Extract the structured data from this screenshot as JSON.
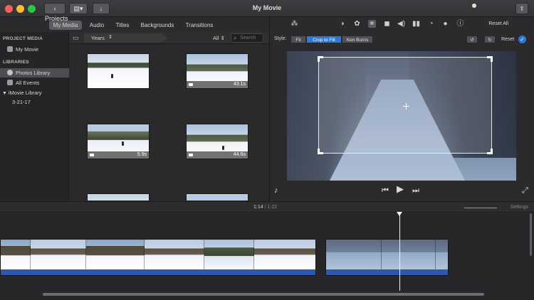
{
  "window": {
    "title": "My Movie",
    "projects_label": "Projects"
  },
  "media_tabs": [
    {
      "label": "My Media",
      "active": true
    },
    {
      "label": "Audio",
      "active": false
    },
    {
      "label": "Titles",
      "active": false
    },
    {
      "label": "Backgrounds",
      "active": false
    },
    {
      "label": "Transitions",
      "active": false
    }
  ],
  "sidebar": {
    "project_heading": "PROJECT MEDIA",
    "project_item": "My Movie",
    "libraries_heading": "LIBRARIES",
    "items": [
      {
        "label": "Photos Library",
        "selected": true
      },
      {
        "label": "All Events",
        "selected": false
      },
      {
        "label": "iMovie Library",
        "selected": false
      },
      {
        "label": "3-21-17",
        "selected": false
      }
    ]
  },
  "filterbar": {
    "breadcrumb": "Years",
    "filter": "All",
    "search_placeholder": "Search"
  },
  "media_grid": [
    {
      "duration": ""
    },
    {
      "duration": "43.1s"
    },
    {
      "duration": "5.9s"
    },
    {
      "duration": "44.6s"
    }
  ],
  "viewer_toolbar": {
    "reset_all": "Reset All"
  },
  "style_row": {
    "label": "Style:",
    "options": [
      "Fit",
      "Crop to Fill",
      "Ken Burns"
    ],
    "active": "Crop to Fill",
    "reset": "Reset"
  },
  "timeline": {
    "current_time": "1:14",
    "separator": "/",
    "total_time": "1:22",
    "settings": "Settings",
    "zoom_level": 0.3
  },
  "colors": {
    "accent": "#2f79d6",
    "audio_track": "#2f58a8"
  }
}
